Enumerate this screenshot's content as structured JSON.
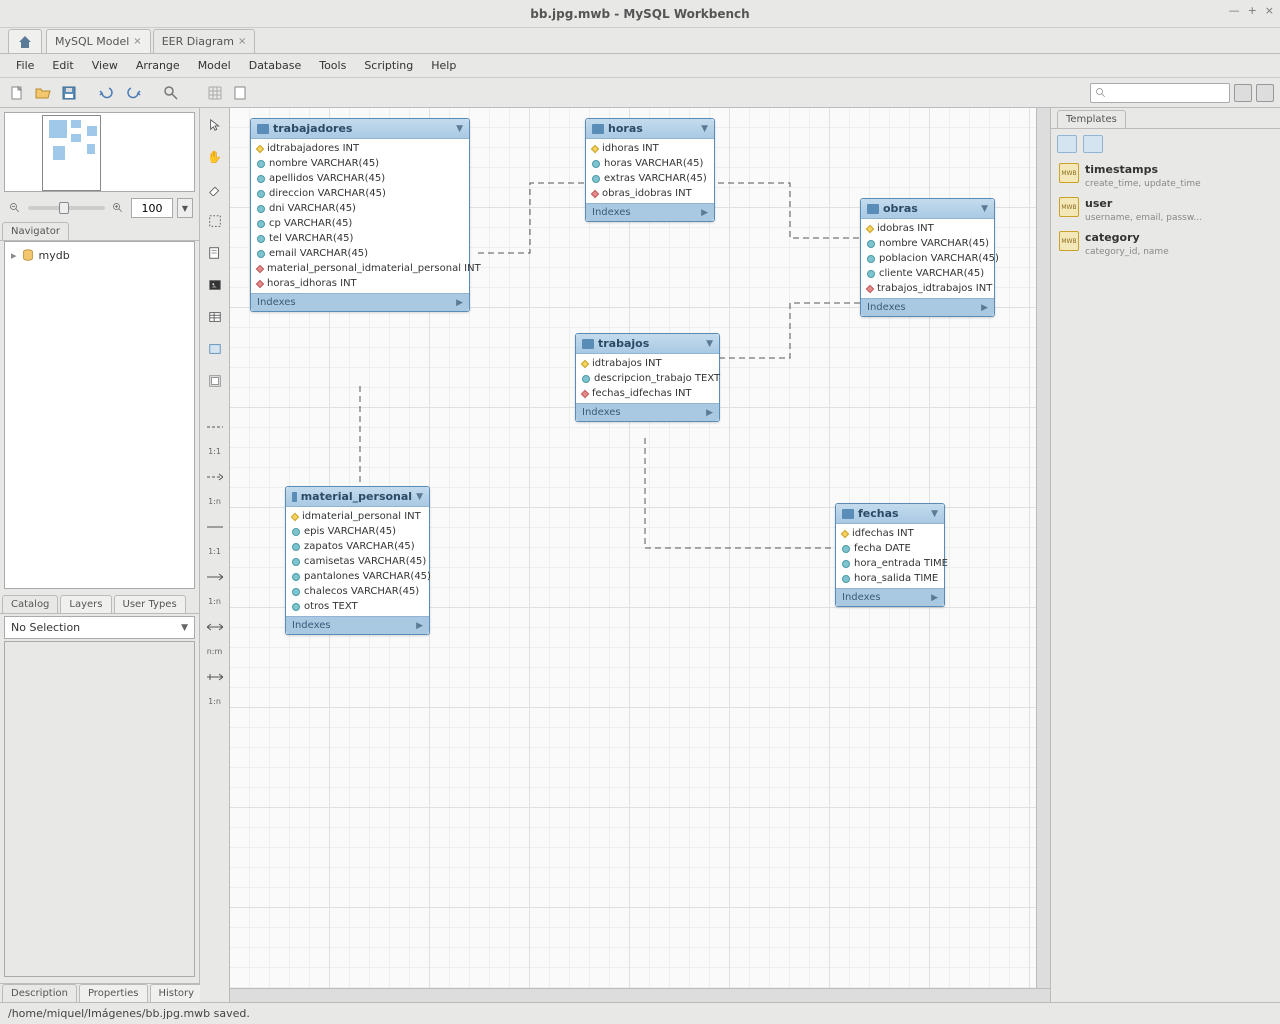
{
  "window": {
    "title": "bb.jpg.mwb - MySQL Workbench"
  },
  "tabs": {
    "model": "MySQL Model",
    "eer": "EER Diagram"
  },
  "menu": [
    "File",
    "Edit",
    "View",
    "Arrange",
    "Model",
    "Database",
    "Tools",
    "Scripting",
    "Help"
  ],
  "zoom": {
    "value": "100"
  },
  "left": {
    "navigator_tab": "Navigator",
    "catalog_tab": "Catalog",
    "layers_tab": "Layers",
    "usertypes_tab": "User Types",
    "tree_db": "mydb",
    "no_selection": "No Selection",
    "desc_tab": "Description",
    "props_tab": "Properties",
    "hist_tab": "History"
  },
  "palette_labels": {
    "rel11": "1:1",
    "rel1n_a": "1:n",
    "rel11_b": "1:1",
    "rel1n_b": "1:n",
    "relnm": "n:m",
    "rel1n_c": "1:n"
  },
  "entities": {
    "trabajadores": {
      "title": "trabajadores",
      "indexes": "Indexes",
      "cols": [
        {
          "k": "pk",
          "t": "idtrabajadores INT"
        },
        {
          "k": "attr",
          "t": "nombre VARCHAR(45)"
        },
        {
          "k": "attr",
          "t": "apellidos VARCHAR(45)"
        },
        {
          "k": "attr",
          "t": "direccion VARCHAR(45)"
        },
        {
          "k": "attr",
          "t": "dni VARCHAR(45)"
        },
        {
          "k": "attr",
          "t": "cp VARCHAR(45)"
        },
        {
          "k": "attr",
          "t": "tel VARCHAR(45)"
        },
        {
          "k": "attr",
          "t": "email VARCHAR(45)"
        },
        {
          "k": "fk",
          "t": "material_personal_idmaterial_personal INT"
        },
        {
          "k": "fk",
          "t": "horas_idhoras INT"
        }
      ]
    },
    "horas": {
      "title": "horas",
      "indexes": "Indexes",
      "cols": [
        {
          "k": "pk",
          "t": "idhoras INT"
        },
        {
          "k": "attr",
          "t": "horas VARCHAR(45)"
        },
        {
          "k": "attr",
          "t": "extras VARCHAR(45)"
        },
        {
          "k": "fk",
          "t": "obras_idobras INT"
        }
      ]
    },
    "obras": {
      "title": "obras",
      "indexes": "Indexes",
      "cols": [
        {
          "k": "pk",
          "t": "idobras INT"
        },
        {
          "k": "attr",
          "t": "nombre VARCHAR(45)"
        },
        {
          "k": "attr",
          "t": "poblacion VARCHAR(45)"
        },
        {
          "k": "attr",
          "t": "cliente VARCHAR(45)"
        },
        {
          "k": "fk",
          "t": "trabajos_idtrabajos INT"
        }
      ]
    },
    "trabajos": {
      "title": "trabajos",
      "indexes": "Indexes",
      "cols": [
        {
          "k": "pk",
          "t": "idtrabajos INT"
        },
        {
          "k": "attr",
          "t": "descripcion_trabajo TEXT"
        },
        {
          "k": "fk",
          "t": "fechas_idfechas INT"
        }
      ]
    },
    "material_personal": {
      "title": "material_personal",
      "indexes": "Indexes",
      "cols": [
        {
          "k": "pk",
          "t": "idmaterial_personal INT"
        },
        {
          "k": "attr",
          "t": "epis VARCHAR(45)"
        },
        {
          "k": "attr",
          "t": "zapatos VARCHAR(45)"
        },
        {
          "k": "attr",
          "t": "camisetas VARCHAR(45)"
        },
        {
          "k": "attr",
          "t": "pantalones VARCHAR(45)"
        },
        {
          "k": "attr",
          "t": "chalecos VARCHAR(45)"
        },
        {
          "k": "attr",
          "t": "otros TEXT"
        }
      ]
    },
    "fechas": {
      "title": "fechas",
      "indexes": "Indexes",
      "cols": [
        {
          "k": "pk",
          "t": "idfechas INT"
        },
        {
          "k": "attr",
          "t": "fecha DATE"
        },
        {
          "k": "attr",
          "t": "hora_entrada TIME"
        },
        {
          "k": "attr",
          "t": "hora_salida TIME"
        }
      ]
    }
  },
  "right": {
    "templates_tab": "Templates",
    "items": [
      {
        "name": "timestamps",
        "desc": "create_time, update_time"
      },
      {
        "name": "user",
        "desc": "username, email, passw..."
      },
      {
        "name": "category",
        "desc": "category_id, name"
      }
    ]
  },
  "status": "/home/miquel/Imágenes/bb.jpg.mwb saved."
}
